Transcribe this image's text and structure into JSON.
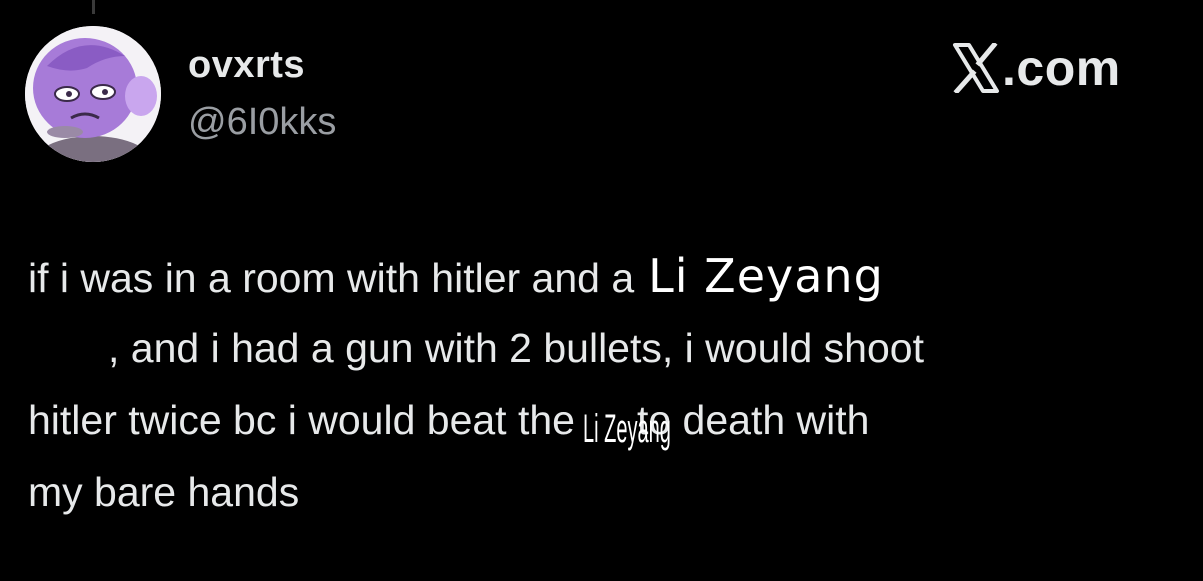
{
  "post": {
    "display_name": "ovxrts",
    "handle": "@6I0kks",
    "domain_label": ".com",
    "avatar_icon": "purple-cartoon-character-avatar",
    "brand_icon": "x-logo-icon",
    "body": {
      "line1_text": "if i was in a room with hitler and a",
      "overlay_name": "Li Zeyang",
      "line2_text": ", and i had a gun with 2 bullets, i would shoot",
      "line3_before": "hitler twice bc i would beat the",
      "overlay_name_small": "Li Zeyang",
      "line3_after": "to death with",
      "line4_text": "my bare hands"
    }
  },
  "colors": {
    "background": "#000000",
    "primary_text": "#e7e9ea",
    "secondary_text": "#9a9ea3",
    "avatar_purple": "#a77bd8"
  }
}
